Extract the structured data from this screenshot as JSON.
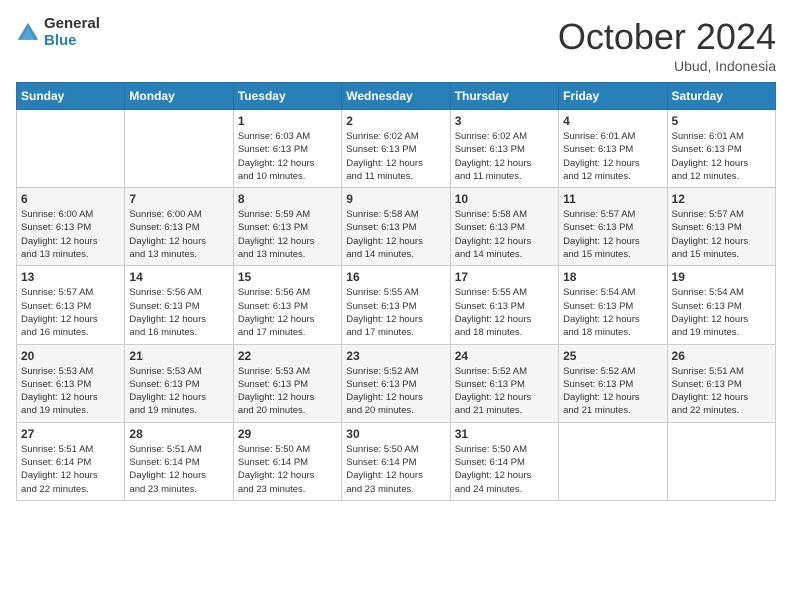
{
  "header": {
    "logo_general": "General",
    "logo_blue": "Blue",
    "month_title": "October 2024",
    "location": "Ubud, Indonesia"
  },
  "days_of_week": [
    "Sunday",
    "Monday",
    "Tuesday",
    "Wednesday",
    "Thursday",
    "Friday",
    "Saturday"
  ],
  "weeks": [
    [
      {
        "day": "",
        "info": ""
      },
      {
        "day": "",
        "info": ""
      },
      {
        "day": "1",
        "info": "Sunrise: 6:03 AM\nSunset: 6:13 PM\nDaylight: 12 hours\nand 10 minutes."
      },
      {
        "day": "2",
        "info": "Sunrise: 6:02 AM\nSunset: 6:13 PM\nDaylight: 12 hours\nand 11 minutes."
      },
      {
        "day": "3",
        "info": "Sunrise: 6:02 AM\nSunset: 6:13 PM\nDaylight: 12 hours\nand 11 minutes."
      },
      {
        "day": "4",
        "info": "Sunrise: 6:01 AM\nSunset: 6:13 PM\nDaylight: 12 hours\nand 12 minutes."
      },
      {
        "day": "5",
        "info": "Sunrise: 6:01 AM\nSunset: 6:13 PM\nDaylight: 12 hours\nand 12 minutes."
      }
    ],
    [
      {
        "day": "6",
        "info": "Sunrise: 6:00 AM\nSunset: 6:13 PM\nDaylight: 12 hours\nand 13 minutes."
      },
      {
        "day": "7",
        "info": "Sunrise: 6:00 AM\nSunset: 6:13 PM\nDaylight: 12 hours\nand 13 minutes."
      },
      {
        "day": "8",
        "info": "Sunrise: 5:59 AM\nSunset: 6:13 PM\nDaylight: 12 hours\nand 13 minutes."
      },
      {
        "day": "9",
        "info": "Sunrise: 5:58 AM\nSunset: 6:13 PM\nDaylight: 12 hours\nand 14 minutes."
      },
      {
        "day": "10",
        "info": "Sunrise: 5:58 AM\nSunset: 6:13 PM\nDaylight: 12 hours\nand 14 minutes."
      },
      {
        "day": "11",
        "info": "Sunrise: 5:57 AM\nSunset: 6:13 PM\nDaylight: 12 hours\nand 15 minutes."
      },
      {
        "day": "12",
        "info": "Sunrise: 5:57 AM\nSunset: 6:13 PM\nDaylight: 12 hours\nand 15 minutes."
      }
    ],
    [
      {
        "day": "13",
        "info": "Sunrise: 5:57 AM\nSunset: 6:13 PM\nDaylight: 12 hours\nand 16 minutes."
      },
      {
        "day": "14",
        "info": "Sunrise: 5:56 AM\nSunset: 6:13 PM\nDaylight: 12 hours\nand 16 minutes."
      },
      {
        "day": "15",
        "info": "Sunrise: 5:56 AM\nSunset: 6:13 PM\nDaylight: 12 hours\nand 17 minutes."
      },
      {
        "day": "16",
        "info": "Sunrise: 5:55 AM\nSunset: 6:13 PM\nDaylight: 12 hours\nand 17 minutes."
      },
      {
        "day": "17",
        "info": "Sunrise: 5:55 AM\nSunset: 6:13 PM\nDaylight: 12 hours\nand 18 minutes."
      },
      {
        "day": "18",
        "info": "Sunrise: 5:54 AM\nSunset: 6:13 PM\nDaylight: 12 hours\nand 18 minutes."
      },
      {
        "day": "19",
        "info": "Sunrise: 5:54 AM\nSunset: 6:13 PM\nDaylight: 12 hours\nand 19 minutes."
      }
    ],
    [
      {
        "day": "20",
        "info": "Sunrise: 5:53 AM\nSunset: 6:13 PM\nDaylight: 12 hours\nand 19 minutes."
      },
      {
        "day": "21",
        "info": "Sunrise: 5:53 AM\nSunset: 6:13 PM\nDaylight: 12 hours\nand 19 minutes."
      },
      {
        "day": "22",
        "info": "Sunrise: 5:53 AM\nSunset: 6:13 PM\nDaylight: 12 hours\nand 20 minutes."
      },
      {
        "day": "23",
        "info": "Sunrise: 5:52 AM\nSunset: 6:13 PM\nDaylight: 12 hours\nand 20 minutes."
      },
      {
        "day": "24",
        "info": "Sunrise: 5:52 AM\nSunset: 6:13 PM\nDaylight: 12 hours\nand 21 minutes."
      },
      {
        "day": "25",
        "info": "Sunrise: 5:52 AM\nSunset: 6:13 PM\nDaylight: 12 hours\nand 21 minutes."
      },
      {
        "day": "26",
        "info": "Sunrise: 5:51 AM\nSunset: 6:13 PM\nDaylight: 12 hours\nand 22 minutes."
      }
    ],
    [
      {
        "day": "27",
        "info": "Sunrise: 5:51 AM\nSunset: 6:14 PM\nDaylight: 12 hours\nand 22 minutes."
      },
      {
        "day": "28",
        "info": "Sunrise: 5:51 AM\nSunset: 6:14 PM\nDaylight: 12 hours\nand 23 minutes."
      },
      {
        "day": "29",
        "info": "Sunrise: 5:50 AM\nSunset: 6:14 PM\nDaylight: 12 hours\nand 23 minutes."
      },
      {
        "day": "30",
        "info": "Sunrise: 5:50 AM\nSunset: 6:14 PM\nDaylight: 12 hours\nand 23 minutes."
      },
      {
        "day": "31",
        "info": "Sunrise: 5:50 AM\nSunset: 6:14 PM\nDaylight: 12 hours\nand 24 minutes."
      },
      {
        "day": "",
        "info": ""
      },
      {
        "day": "",
        "info": ""
      }
    ]
  ]
}
